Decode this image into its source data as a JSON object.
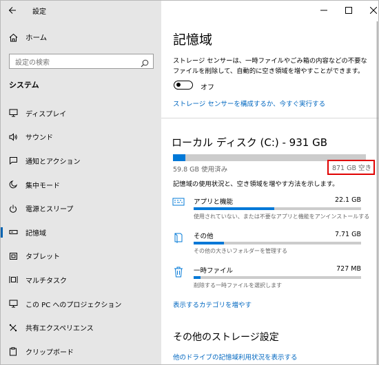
{
  "window": {
    "title": "設定",
    "controls": [
      "minimize",
      "maximize",
      "close"
    ]
  },
  "sidebar": {
    "home_label": "ホーム",
    "search_placeholder": "設定の検索",
    "section": "システム",
    "items": [
      {
        "label": "ディスプレイ",
        "icon": "monitor-icon"
      },
      {
        "label": "サウンド",
        "icon": "speaker-icon"
      },
      {
        "label": "通知とアクション",
        "icon": "notification-icon"
      },
      {
        "label": "集中モード",
        "icon": "moon-icon"
      },
      {
        "label": "電源とスリープ",
        "icon": "power-icon"
      },
      {
        "label": "記憶域",
        "icon": "storage-icon",
        "active": true
      },
      {
        "label": "タブレット",
        "icon": "tablet-icon"
      },
      {
        "label": "マルチタスク",
        "icon": "multitask-icon"
      },
      {
        "label": "この PC へのプロジェクション",
        "icon": "projection-icon"
      },
      {
        "label": "共有エクスペリエンス",
        "icon": "share-icon"
      },
      {
        "label": "クリップボード",
        "icon": "clipboard-icon"
      }
    ]
  },
  "main": {
    "title": "記憶域",
    "description": "ストレージ センサーは、一時ファイルやごみ箱の内容などの不要なファイルを削除して、自動的に空き領域を増やすことができます。",
    "toggle_label": "オフ",
    "toggle_on": false,
    "configure_link": "ストレージ センサーを構成するか、今すぐ実行する",
    "drive": {
      "title": "ローカル ディスク (C:) - 931 GB",
      "used_label": "59.8 GB 使用済み",
      "free_label": "871 GB 空き",
      "used_fraction": 0.064
    },
    "explain": "記憶域の使用状況と、空き領域を増やす方法を示します。",
    "categories": [
      {
        "name": "アプリと機能",
        "size": "22.1 GB",
        "fraction": 0.48,
        "desc": "使用されていない、または不要なアプリと機能をアンインストールする",
        "icon": "keyboard-icon"
      },
      {
        "name": "その他",
        "size": "7.71 GB",
        "fraction": 0.18,
        "desc": "その他の大きいフォルダーを管理する",
        "icon": "folder-icon"
      },
      {
        "name": "一時ファイル",
        "size": "727 MB",
        "fraction": 0.04,
        "desc": "削除する一時ファイルを選択します",
        "icon": "trash-icon"
      }
    ],
    "more_link": "表示するカテゴリを増やす",
    "other_title": "その他のストレージ設定",
    "other_link": "他のドライブの記憶域利用状況を表示する"
  },
  "colors": {
    "accent": "#0078d7",
    "link": "#0067c0",
    "sidebar_bg": "#e6e6e6",
    "highlight": "#e00000"
  }
}
